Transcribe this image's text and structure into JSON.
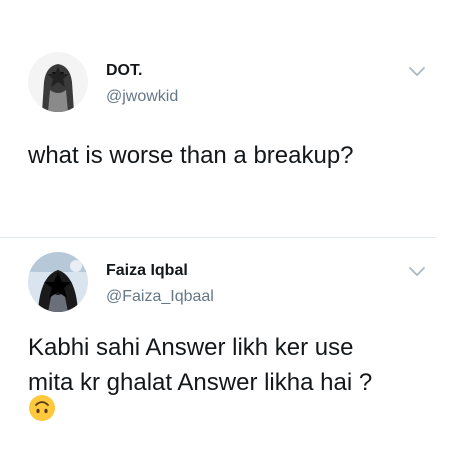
{
  "tweets": [
    {
      "display_name": "DOT.",
      "handle": "@jwowkid",
      "text": "what is worse than a breakup?",
      "avatar_icon": "profile-photo",
      "menu_icon": "chevron-down-icon"
    },
    {
      "display_name": "Faiza Iqbal",
      "handle": "@Faiza_Iqbaal",
      "text_line1": "Kabhi sahi Answer likh ker use",
      "text_line2": "mita kr ghalat Answer likha hai ?",
      "emoji": "upside-down-face",
      "avatar_icon": "profile-photo",
      "menu_icon": "chevron-down-icon"
    }
  ],
  "colors": {
    "text": "#14171a",
    "secondary": "#657786",
    "divider": "#e1e8ed",
    "chevron": "#aab8c2",
    "emoji": "#ffc83d"
  }
}
